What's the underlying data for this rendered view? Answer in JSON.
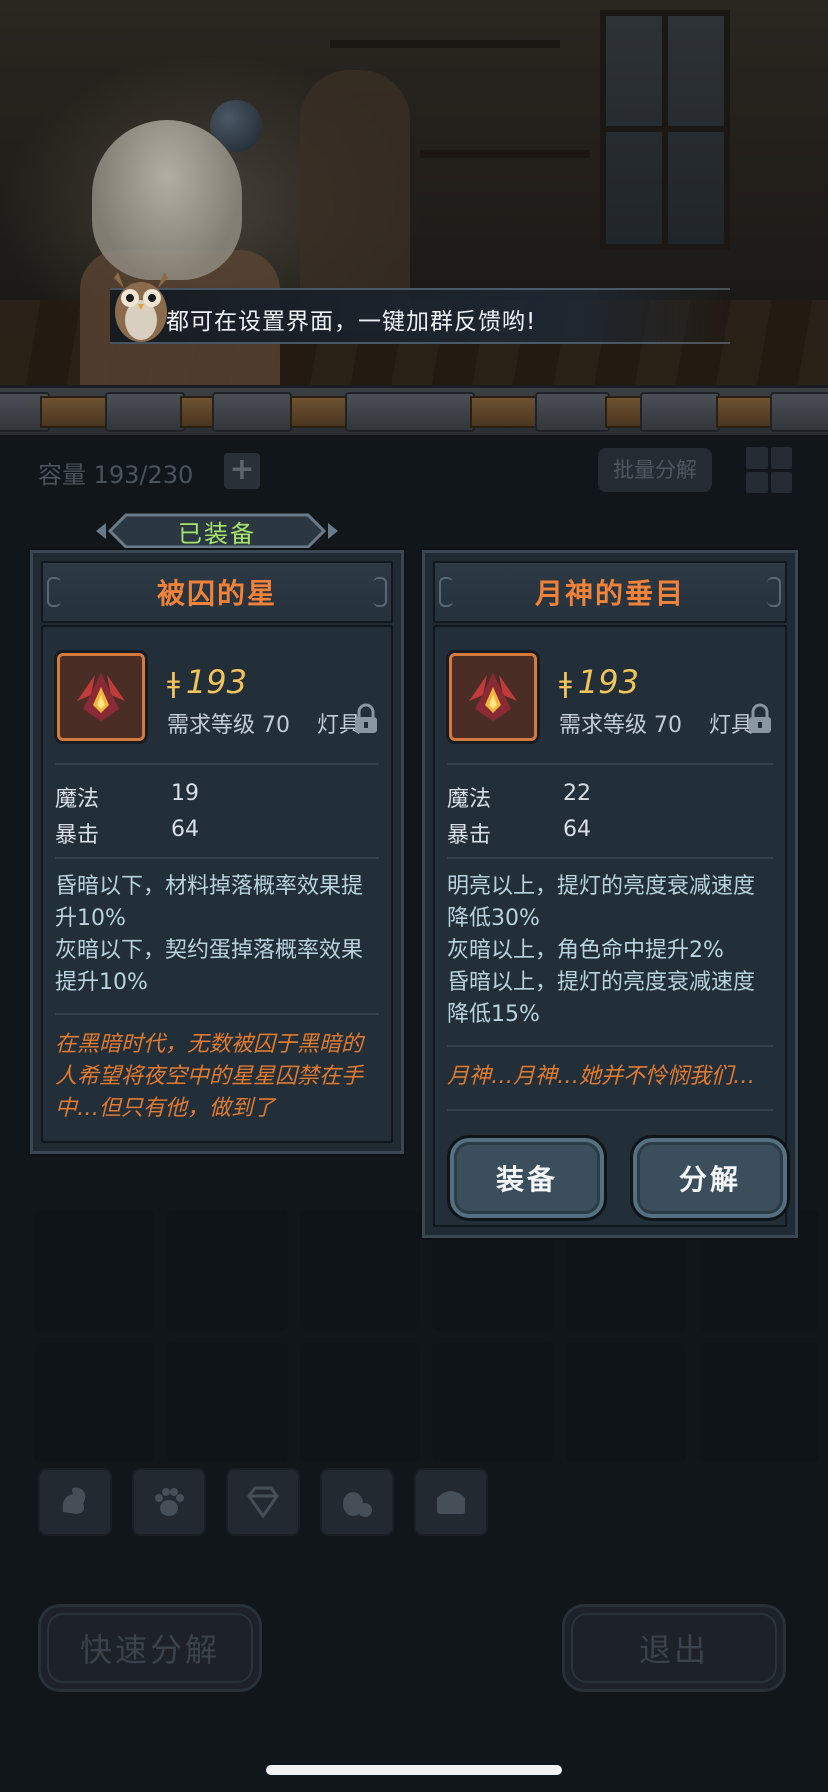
{
  "toast": {
    "message": "都可在设置界面，一键加群反馈哟!"
  },
  "inventory": {
    "capacity_label": "容量 193/230",
    "add_slot_symbol": "+",
    "batch_decompose_label": "批量分解",
    "quick_decompose_label": "快速分解",
    "exit_label": "退出",
    "category_tabs": [
      "squirrel-icon",
      "paw-icon",
      "gem-icon",
      "egg-icon",
      "chest-icon"
    ]
  },
  "equipped_card": {
    "tag": "已装备",
    "title": "被囚的星",
    "power": "193",
    "requirement": "需求等级 70",
    "slot": "灯具",
    "stats": [
      {
        "name": "魔法",
        "value": "19"
      },
      {
        "name": "暴击",
        "value": "64"
      }
    ],
    "effects": [
      "昏暗以下，材料掉落概率效果提升10%",
      "灰暗以下，契约蛋掉落概率效果提升10%"
    ],
    "flavor": "在黑暗时代，无数被囚于黑暗的人希望将夜空中的星星囚禁在手中…但只有他，做到了"
  },
  "compare_card": {
    "title": "月神的垂目",
    "power": "193",
    "requirement": "需求等级 70",
    "slot": "灯具",
    "stats": [
      {
        "name": "魔法",
        "value": "22"
      },
      {
        "name": "暴击",
        "value": "64"
      }
    ],
    "effects": [
      "明亮以上，提灯的亮度衰减速度降低30%",
      "灰暗以上，角色命中提升2%",
      "昏暗以上，提灯的亮度衰减速度降低15%"
    ],
    "flavor": "月神…月神…她并不怜悯我们…",
    "equip_label": "装备",
    "decompose_label": "分解"
  },
  "colors": {
    "title_orange": "#f0823a",
    "power_gold": "#f2c35a",
    "equipped_green": "#a6e36a",
    "effect_blue": "#b8d2de",
    "card_bg": "#222e38"
  }
}
